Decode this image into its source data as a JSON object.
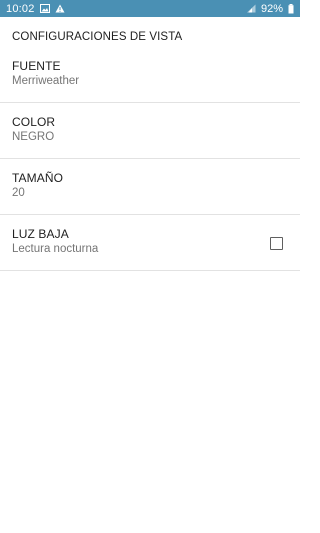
{
  "status_bar": {
    "time": "10:02",
    "battery": "92%",
    "icons": [
      "gallery-icon",
      "warning-icon",
      "signal-icon",
      "battery-icon"
    ],
    "background": "#4a90b4"
  },
  "screen": {
    "section_title": "CONFIGURACIONES DE VISTA"
  },
  "preferences": [
    {
      "title": "FUENTE",
      "summary": "Merriweather"
    },
    {
      "title": "COLOR",
      "summary": "NEGRO"
    },
    {
      "title": "TAMAÑO",
      "summary": "20"
    },
    {
      "title": "LUZ BAJA",
      "summary": "Lectura nocturna",
      "checked": false
    }
  ]
}
